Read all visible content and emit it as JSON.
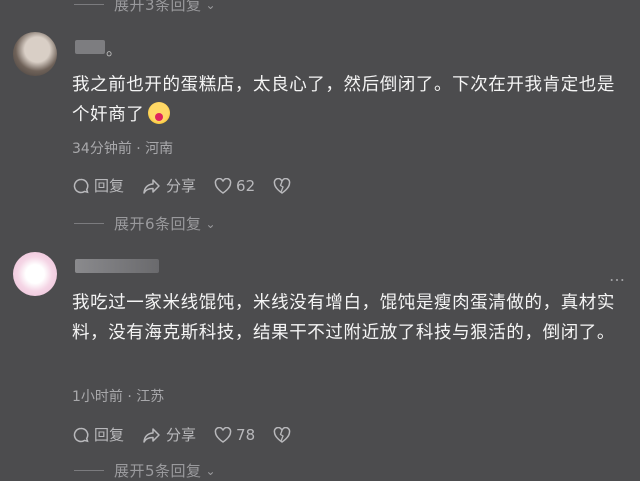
{
  "expand_top": {
    "label": "展开3条回复"
  },
  "comment1": {
    "username_suffix": "。",
    "text": "我之前也开的蛋糕店，太良心了，然后倒闭了。下次在开我肯定也是个奸商了",
    "meta": "34分钟前 · 河南",
    "reply_label": "回复",
    "share_label": "分享",
    "likes": "62",
    "expand_label": "展开6条回复"
  },
  "comment2": {
    "text": "我吃过一家米线馄饨，米线没有增白，馄饨是瘦肉蛋清做的，真材实料，没有海克斯科技，结果干不过附近放了科技与狠活的，倒闭了。",
    "meta": "1小时前 · 江苏",
    "reply_label": "回复",
    "share_label": "分享",
    "likes": "78",
    "expand_label": "展开5条回复"
  },
  "more_icon": "…",
  "icons": [
    "reply-icon",
    "share-icon",
    "heart-icon",
    "dislike-icon",
    "chevron-down-icon",
    "more-icon"
  ]
}
